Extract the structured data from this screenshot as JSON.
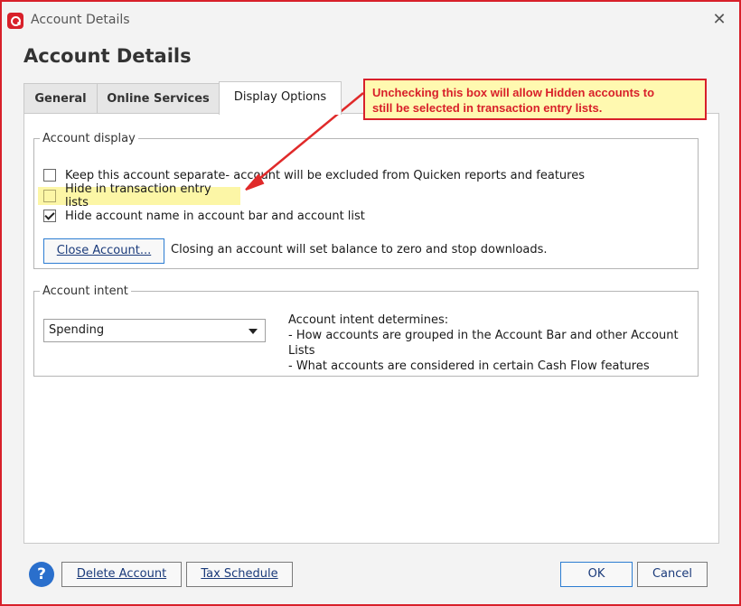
{
  "window": {
    "title": "Account Details",
    "heading": "Account Details"
  },
  "tabs": [
    {
      "label": "General",
      "active": false
    },
    {
      "label": "Online Services",
      "active": false
    },
    {
      "label": "Display Options",
      "active": true
    }
  ],
  "account_display": {
    "legend": "Account display",
    "options": [
      {
        "label": "Keep this account separate- account will be excluded from Quicken reports and features",
        "checked": false
      },
      {
        "label": "Hide in transaction entry lists",
        "checked": false,
        "highlighted": true
      },
      {
        "label": "Hide account name in account bar and account list",
        "checked": true
      }
    ],
    "close_button": "Close Account...",
    "close_note": "Closing an account will set balance to zero and stop downloads."
  },
  "account_intent": {
    "legend": "Account intent",
    "selected": "Spending",
    "desc_title": "Account intent determines:",
    "desc_line1": "- How accounts are grouped in the Account Bar and other Account",
    "desc_line1b": "Lists",
    "desc_line2": "- What accounts are considered in certain Cash Flow features"
  },
  "footer": {
    "help": "?",
    "delete_button": "Delete Account",
    "tax_button": "Tax Schedule",
    "ok_button": "OK",
    "cancel_button": "Cancel"
  },
  "annotation": {
    "text_line1": "Unchecking this box will allow Hidden accounts to",
    "text_line2": "still be selected in transaction entry lists."
  },
  "colors": {
    "accent": "#d8202a",
    "highlight": "#fcf6a6",
    "link_blue": "#1a3a7a",
    "help_blue": "#2a6fcc"
  },
  "icons": [
    "quicken-logo-icon",
    "close-icon",
    "checkbox-icon",
    "chevron-down-icon",
    "help-icon",
    "arrow-icon"
  ]
}
